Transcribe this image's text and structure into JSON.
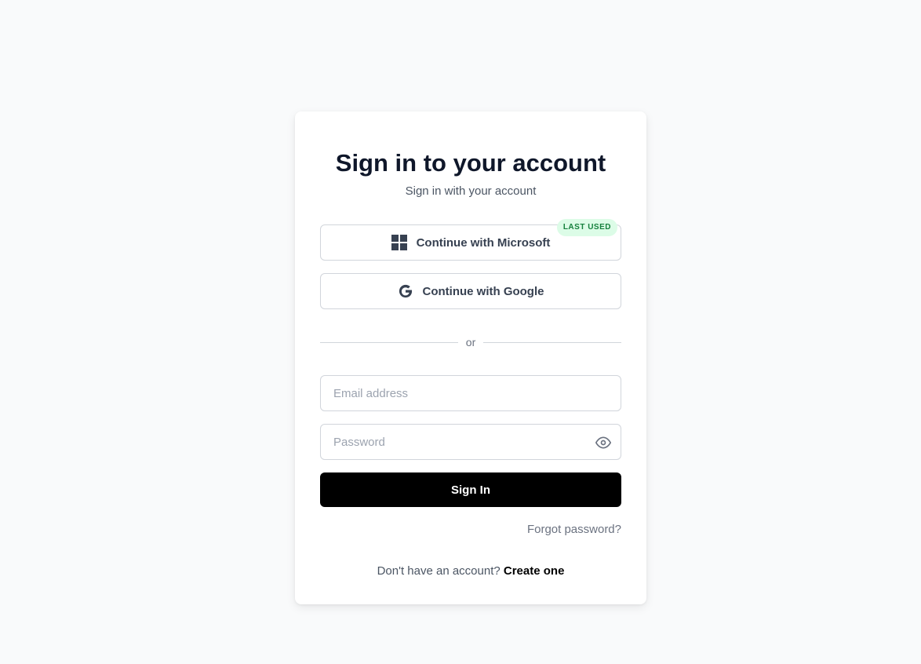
{
  "header": {
    "title": "Sign in to your account",
    "subtitle": "Sign in with your account"
  },
  "oauth": {
    "microsoft": {
      "label": "Continue with Microsoft",
      "icon": "microsoft-icon",
      "badge": "LAST USED"
    },
    "google": {
      "label": "Continue with Google",
      "icon": "google-icon"
    }
  },
  "divider": {
    "text": "or"
  },
  "form": {
    "email": {
      "placeholder": "Email address",
      "value": ""
    },
    "password": {
      "placeholder": "Password",
      "value": "",
      "toggle_icon": "eye-icon"
    },
    "submit_label": "Sign In",
    "forgot_label": "Forgot password?"
  },
  "footer": {
    "prompt": "Don't have an account?",
    "link_label": "Create one"
  },
  "colors": {
    "background": "#f9fafb",
    "primary_button": "#000000",
    "badge_bg": "#dcfce7",
    "badge_text": "#15803d"
  }
}
